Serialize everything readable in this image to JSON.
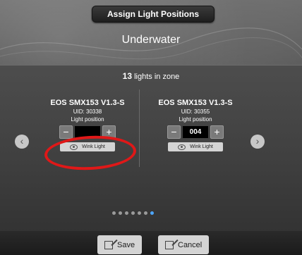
{
  "header": {
    "title": "Assign Light Positions",
    "zone_name": "Underwater"
  },
  "zone": {
    "count": "13",
    "count_suffix": "lights in zone"
  },
  "fixtures": [
    {
      "name": "EOS SMX153 V1.3-S",
      "uid": "UID: 30338",
      "position_label": "Light position",
      "position_value": "",
      "wink_label": "Wink Light"
    },
    {
      "name": "EOS SMX153 V1.3-S",
      "uid": "UID: 30355",
      "position_label": "Light position",
      "position_value": "004",
      "wink_label": "Wink Light"
    }
  ],
  "controls": {
    "minus": "−",
    "plus": "+",
    "prev": "‹",
    "next": "›"
  },
  "pagination": {
    "pages": 7,
    "active_index": 6
  },
  "footer": {
    "save_label": "Save",
    "cancel_label": "Cancel"
  },
  "colors": {
    "active_dot": "#4da6ff",
    "highlight_ring": "#e01818"
  }
}
